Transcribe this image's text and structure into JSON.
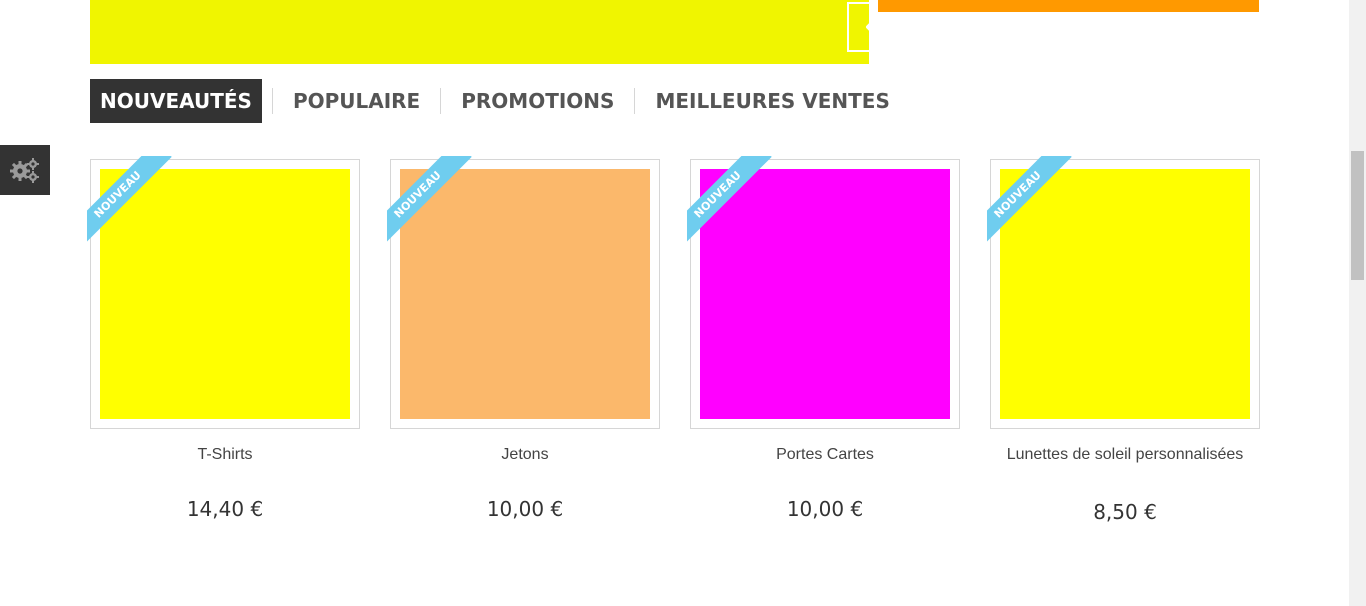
{
  "colors": {
    "banner": "#f0f500",
    "side_bar": "#ff9900",
    "ribbon": "#6fcdef",
    "tab_active_bg": "#333333"
  },
  "slider": {
    "prev_icon": "chevron-left-icon",
    "next_icon": "chevron-right-icon"
  },
  "tabs": [
    {
      "label": "NOUVEAUTÉS",
      "active": true
    },
    {
      "label": "POPULAIRE",
      "active": false
    },
    {
      "label": "PROMOTIONS",
      "active": false
    },
    {
      "label": "MEILLEURES VENTES",
      "active": false
    }
  ],
  "settings": {
    "icon": "gears-icon"
  },
  "products": [
    {
      "name": "T-Shirts",
      "price": "14,40 €",
      "badge": "NOUVEAU",
      "image_color": "#ffff00"
    },
    {
      "name": "Jetons",
      "price": "10,00 €",
      "badge": "NOUVEAU",
      "image_color": "#fbb86b"
    },
    {
      "name": "Portes Cartes",
      "price": "10,00 €",
      "badge": "NOUVEAU",
      "image_color": "#ff00ff"
    },
    {
      "name": "Lunettes de soleil personnalisées",
      "price": "8,50 €",
      "badge": "NOUVEAU",
      "image_color": "#ffff00"
    }
  ]
}
